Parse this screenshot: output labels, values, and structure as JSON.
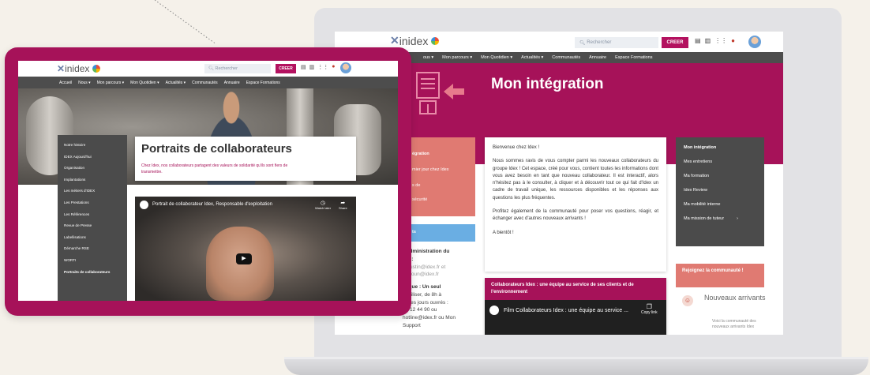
{
  "brand": {
    "logo_text": "inidex"
  },
  "laptop": {
    "search_placeholder": "Rechercher",
    "create_label": "CREER",
    "nav": [
      "ous ▾",
      "Mon parcours ▾",
      "Mon Quotidien ▾",
      "Actualités ▾",
      "Communautés",
      "Annuaire",
      "Espace Formations"
    ],
    "hero_title": "Mon intégration",
    "left_col": {
      "item1": "égration",
      "item2": "mier jour chez Idex",
      "item3": "s de",
      "item4": "sécurité",
      "blue": "ts"
    },
    "left_text": [
      "t Administration du",
      "nel :",
      "rcoustin@idex.fr et",
      "nanoun@idex.fr",
      "",
      "atique : Un seul",
      "à utiliser, de 8h à",
      "us les jours ouvrés :",
      "01 12 44 90 ou",
      "hotline@idex.fr ou Mon",
      "Support"
    ],
    "welcome": {
      "title": "Bienvenue chez Idex !",
      "para1": "Nous sommes ravis de vous compter parmi les nouveaux collaborateurs du groupe Idex ! Cet espace, créé pour vous, contient toutes les informations dont vous avez besoin en tant que nouveau collaborateur. Il est interactif, alors n'hésitez pas à le consulter, à cliquer et à découvrir tout ce qui fait d'Idex un cadre de travail unique, les ressources disponibles et les réponses aux questions les plus fréquentes.",
      "para2": "Profitez également de la communauté pour poser vos questions, réagir, et échanger avec d'autres nouveaux arrivants !",
      "para3": "A bientôt !"
    },
    "video_card": {
      "heading": "Collaborateurs Idex : une équipe au service de ses clients et de l'environnement",
      "video_title": "Film Collaborateurs Idex : une équipe au service ...",
      "copy_link": "Copy link"
    },
    "side_menu": [
      "Mon intégration",
      "Mes entretiens",
      "Ma formation",
      "Idex Review",
      "Ma mobilité interne",
      "Ma mission de tuteur"
    ],
    "join": "Rejoignez la communauté !",
    "new_arrivals": {
      "title": "Nouveaux arrivants",
      "sub": "Voici la communauté des nouveaux arrivants Idex"
    }
  },
  "tablet": {
    "search_placeholder": "Rechercher",
    "create_label": "CREER",
    "nav": [
      "Accueil",
      "Nous ▾",
      "Mon parcours ▾",
      "Mon Quotidien ▾",
      "Actualités ▾",
      "Communautés",
      "Annuaire",
      "Espace Formations"
    ],
    "side_menu": [
      "Notre histoire",
      "IDEX Aujourd'hui",
      "Organisation",
      "Implantations",
      "Les métiers d'IDEX",
      "Les Prestations",
      "Les Références",
      "Revue de Presse",
      "Labellisations",
      "Démarche RSE",
      "WORTI",
      "Portraits de collaborateurs"
    ],
    "page_title": "Portraits de collaborateurs",
    "subtitle": "Chez Idex, nos collaborateurs partagent des valeurs de solidarité qu'ils sont fiers de transmettre.",
    "video_title": "Portrait de collaborateur Idex, Responsable d'exploitation",
    "watch_later": "Watch later",
    "share": "Share"
  }
}
